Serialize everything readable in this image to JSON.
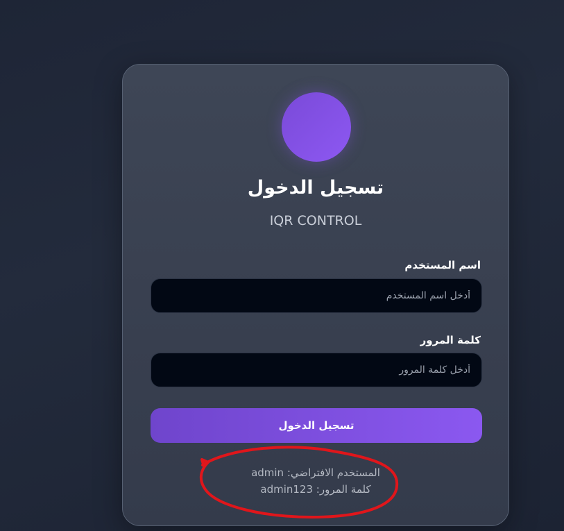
{
  "login": {
    "title": "تسجيل الدخول",
    "app_name": "IQR CONTROL",
    "username_label": "اسم المستخدم",
    "username_placeholder": "أدخل اسم المستخدم",
    "password_label": "كلمة المرور",
    "password_placeholder": "أدخل كلمة المرور",
    "submit_label": "تسجيل الدخول",
    "default_user_hint": "المستخدم الافتراضي: admin",
    "default_password_hint": "كلمة المرور: admin123"
  },
  "colors": {
    "accent": "#8b58f0",
    "accent_dark": "#6f45cc",
    "card_background": "#3b4353",
    "page_background": "#1f2637",
    "input_background": "#020814",
    "annotation_red": "#e0161b"
  },
  "icons": {
    "logo": "logo-circle-icon"
  }
}
